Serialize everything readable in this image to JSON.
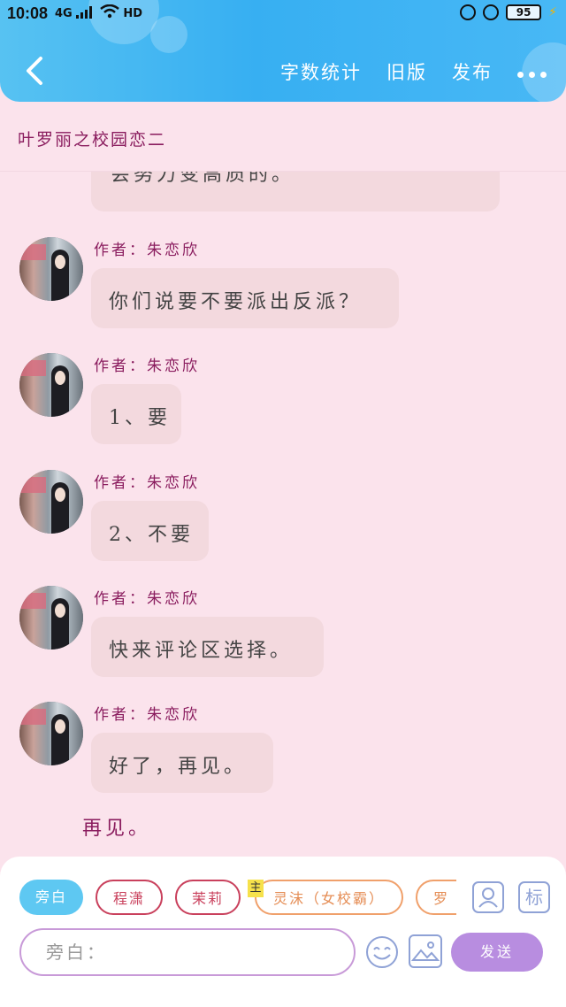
{
  "status_bar": {
    "time": "10:08",
    "signal": "4G",
    "hd": "HD",
    "battery": "95"
  },
  "header": {
    "actions": [
      "字数统计",
      "旧版",
      "发布"
    ],
    "more_label": "more"
  },
  "story": {
    "title": "叶罗丽之校园恋二"
  },
  "chat": {
    "partial_text": "会努力变高质的。",
    "messages": [
      {
        "author": "作者：朱恋欣",
        "text": "你们说要不要派出反派？"
      },
      {
        "author": "作者：朱恋欣",
        "text": "1、要"
      },
      {
        "author": "作者：朱恋欣",
        "text": "2、不要"
      },
      {
        "author": "作者：朱恋欣",
        "text": "快来评论区选择。"
      },
      {
        "author": "作者：朱恋欣",
        "text": "好了，再见。"
      }
    ],
    "narration": "再见。"
  },
  "composer": {
    "chips": [
      "旁白",
      "程潇",
      "茉莉",
      "灵沫（女校霸）",
      "罗"
    ],
    "main_tag": "主",
    "biao_label": "标",
    "input_placeholder": "旁白：",
    "send_label": "发送"
  },
  "colors": {
    "header_blue": "#37aff2",
    "background_pink": "#fbe3ec",
    "bubble": "#f3d9de",
    "author_text": "#8a1c5e",
    "send_purple": "#b88de0"
  }
}
